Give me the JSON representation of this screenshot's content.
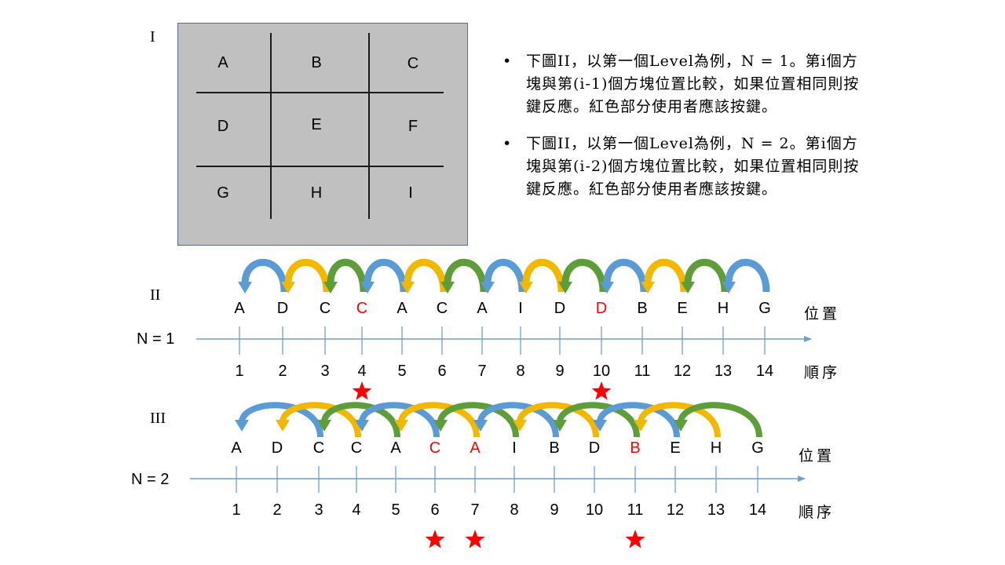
{
  "grid": {
    "label": "I",
    "cells": [
      "A",
      "B",
      "C",
      "D",
      "E",
      "F",
      "G",
      "H",
      "I"
    ]
  },
  "bullets": [
    "下圖II，以第一個Level為例，N = 1。第i個方塊與第(i-1)個方塊位置比較，如果位置相同則按鍵反應。紅色部分使用者應該按鍵。",
    "下圖II，以第一個Level為例，N = 2。第i個方塊與第(i-2)個方塊位置比較，如果位置相同則按鍵反應。紅色部分使用者應該按鍵。"
  ],
  "colors": {
    "blue": "#5b9bd5",
    "yellow": "#f2b800",
    "green": "#5e9e3a",
    "axis": "#6f9fce",
    "red": "#ff0000"
  },
  "rows": [
    {
      "label": "II",
      "n_label": "N = 1",
      "position_label": "位置",
      "order_label": "順序",
      "letters": [
        "A",
        "D",
        "C",
        "C",
        "A",
        "C",
        "A",
        "I",
        "D",
        "D",
        "B",
        "E",
        "H",
        "G"
      ],
      "red_orders": [
        4,
        10
      ],
      "orders": [
        1,
        2,
        3,
        4,
        5,
        6,
        7,
        8,
        9,
        10,
        11,
        12,
        13,
        14
      ]
    },
    {
      "label": "III",
      "n_label": "N = 2",
      "position_label": "位置",
      "order_label": "順序",
      "letters": [
        "A",
        "D",
        "C",
        "C",
        "A",
        "C",
        "A",
        "I",
        "B",
        "D",
        "B",
        "E",
        "H",
        "G"
      ],
      "red_orders": [
        6,
        7,
        11
      ],
      "orders": [
        1,
        2,
        3,
        4,
        5,
        6,
        7,
        8,
        9,
        10,
        11,
        12,
        13,
        14
      ]
    }
  ]
}
